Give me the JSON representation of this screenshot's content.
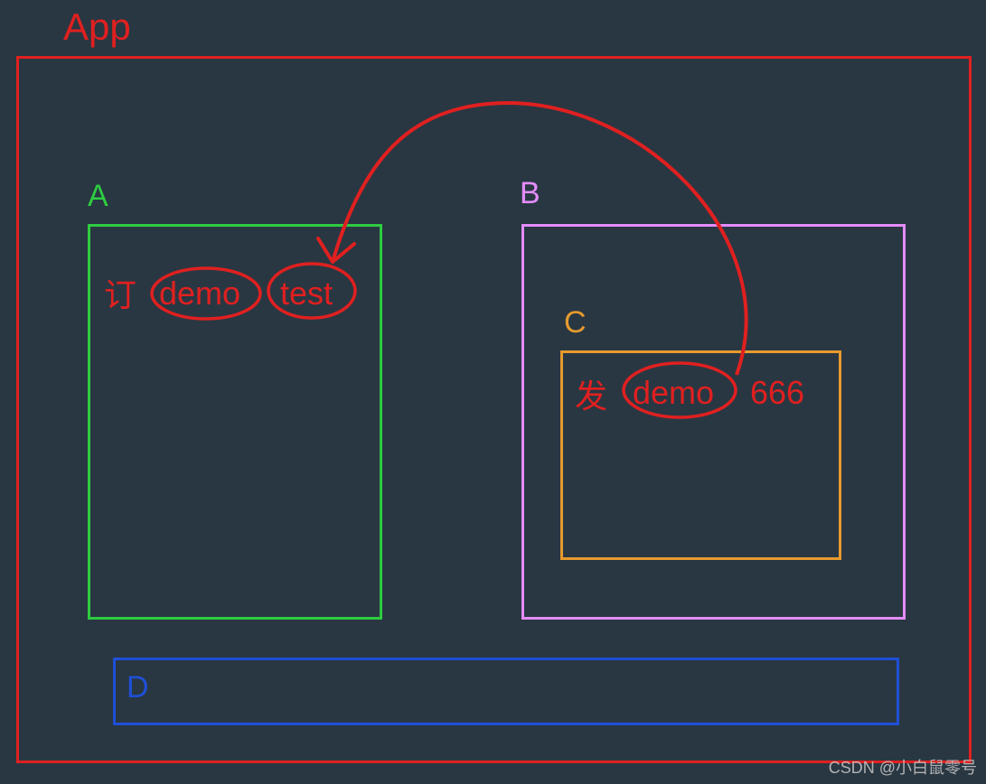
{
  "colors": {
    "bg": "#293742",
    "red": "#e02020",
    "green": "#2ecc40",
    "violet": "#e48cff",
    "orange": "#e69a2e",
    "blue": "#1f4fd6",
    "watermark": "#c8c8c8"
  },
  "labels": {
    "app": "App",
    "a": "A",
    "b": "B",
    "c": "C",
    "d": "D"
  },
  "annotations": {
    "a_subscribe": "订",
    "a_demo": "demo",
    "a_test": "test",
    "c_publish": "发",
    "c_demo": "demo",
    "c_value": "666"
  },
  "relation": {
    "from": "C.demo",
    "to": "A.test",
    "meaning": "发 (publish) demo 666 → 订 (subscribe) demo test"
  },
  "watermark": "CSDN @小白鼠零号"
}
